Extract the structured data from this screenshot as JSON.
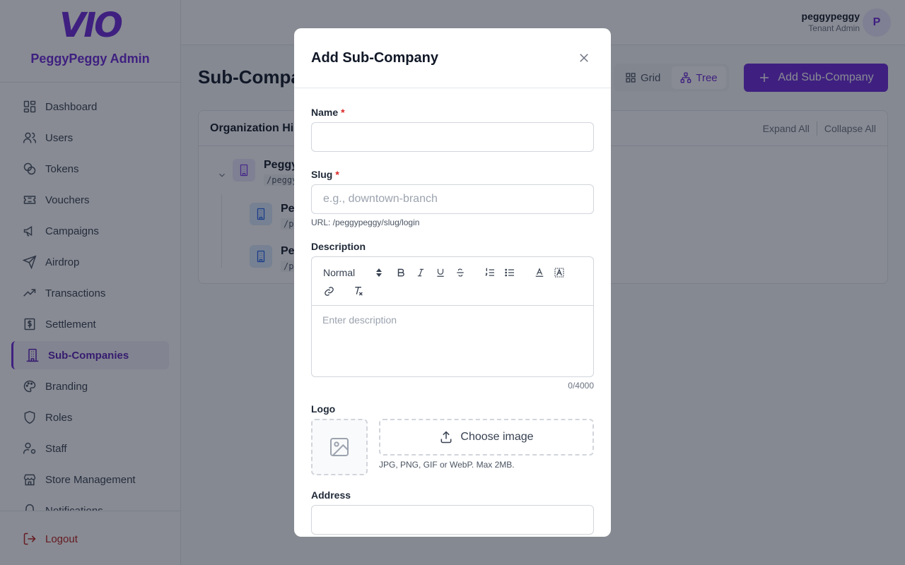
{
  "brand": {
    "logo": "VIO",
    "name": "PeggyPeggy Admin"
  },
  "sidebar": {
    "items": [
      {
        "label": "Dashboard",
        "icon": "dashboard-icon"
      },
      {
        "label": "Users",
        "icon": "users-icon"
      },
      {
        "label": "Tokens",
        "icon": "tokens-icon"
      },
      {
        "label": "Vouchers",
        "icon": "voucher-icon"
      },
      {
        "label": "Campaigns",
        "icon": "megaphone-icon"
      },
      {
        "label": "Airdrop",
        "icon": "send-icon"
      },
      {
        "label": "Transactions",
        "icon": "trending-icon"
      },
      {
        "label": "Settlement",
        "icon": "dollar-icon"
      },
      {
        "label": "Sub-Companies",
        "icon": "building-icon",
        "active": true
      },
      {
        "label": "Branding",
        "icon": "palette-icon"
      },
      {
        "label": "Roles",
        "icon": "shield-icon"
      },
      {
        "label": "Staff",
        "icon": "user-cog-icon"
      },
      {
        "label": "Store Management",
        "icon": "store-icon"
      },
      {
        "label": "Notifications",
        "icon": "bell-icon"
      }
    ],
    "logout": "Logout"
  },
  "header": {
    "user_name": "peggypeggy",
    "user_role": "Tenant Admin",
    "avatar_initial": "P"
  },
  "main": {
    "title": "Sub-Compa",
    "view_grid": "Grid",
    "view_tree": "Tree",
    "add_button": "Add Sub-Company",
    "panel_title": "Organization Hi",
    "expand_all": "Expand All",
    "collapse_all": "Collapse All",
    "tree": {
      "root": {
        "name": "Peggy",
        "slug": "/peggy"
      },
      "children": [
        {
          "name": "Pe",
          "slug": "/p"
        },
        {
          "name": "Pe",
          "slug": "/p"
        }
      ]
    }
  },
  "modal": {
    "title": "Add Sub-Company",
    "name_label": "Name",
    "name_value": "",
    "slug_label": "Slug",
    "slug_placeholder": "e.g., downtown-branch",
    "slug_help": "URL: /peggypeggy/slug/login",
    "required_mark": "*",
    "description_label": "Description",
    "format_select": "Normal",
    "description_placeholder": "Enter description",
    "counter": "0/4000",
    "logo_label": "Logo",
    "choose_image": "Choose image",
    "logo_help": "JPG, PNG, GIF or WebP. Max 2MB.",
    "address_label": "Address",
    "address_value": ""
  },
  "colors": {
    "accent": "#6d28d9",
    "danger": "#dc2626"
  }
}
